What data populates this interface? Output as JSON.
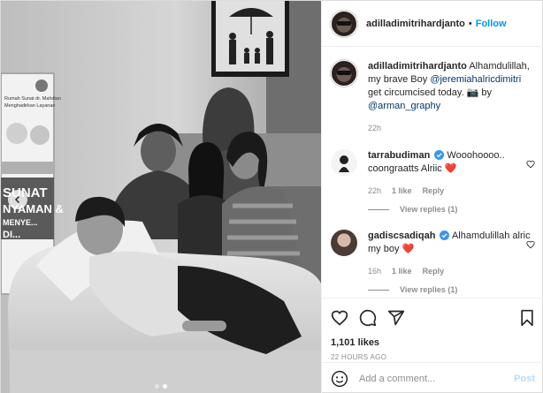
{
  "post": {
    "author": "adilladimitrihardjanto",
    "follow_label": "Follow",
    "separator": "•",
    "more_label": "•••"
  },
  "photo": {
    "banner_lines": [
      "Rumah Sunat dr. Mahdian",
      "Menghadirkan Layanan"
    ],
    "banner_big": [
      "SUNAT",
      "NYAMAN &",
      "MENYE...",
      "DI..."
    ]
  },
  "caption": {
    "username": "adilladimitrihardjanto",
    "text_1": "Alhamdulillah, my brave Boy",
    "mention_1": "@jeremiahalricdimitri",
    "text_2": "get circumcised today. 📷 by",
    "mention_2": "@arman_graphy",
    "time": "22h"
  },
  "comments": [
    {
      "username": "tarrabudiman",
      "verified": true,
      "text": "Wooohoooo.. coongraatts Alriic ❤️",
      "time": "22h",
      "likes": "1 like",
      "reply_label": "Reply",
      "view_replies": "View replies (1)"
    },
    {
      "username": "gadiscsadiqah",
      "verified": true,
      "text": "Alhamdulillah alric my boy ❤️",
      "time": "16h",
      "likes": "1 like",
      "reply_label": "Reply",
      "view_replies": "View replies (1)"
    }
  ],
  "engagement": {
    "likes": "1,101 likes",
    "timestamp": "22 HOURS AGO"
  },
  "add_comment": {
    "placeholder": "Add a comment...",
    "post_label": "Post"
  },
  "icons": [
    "more-icon",
    "heart-icon",
    "comment-icon",
    "share-icon",
    "save-icon",
    "emoji-icon",
    "verified-icon",
    "carousel-prev-icon"
  ],
  "colors": {
    "accent": "#0095f6",
    "verified": "#3897f0",
    "heart_red": "#ed4956",
    "post_disabled": "#b2dffc"
  }
}
